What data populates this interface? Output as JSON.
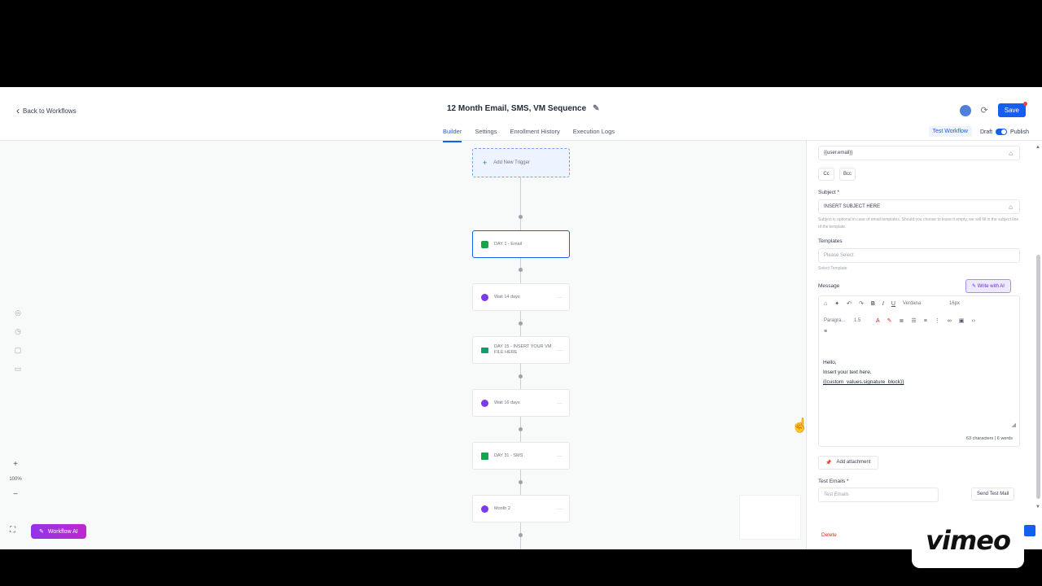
{
  "header": {
    "back_label": "Back to Workflows",
    "title": "12 Month Email, SMS, VM Sequence",
    "tabs": [
      {
        "label": "Builder",
        "active": true
      },
      {
        "label": "Settings"
      },
      {
        "label": "Enrollment History"
      },
      {
        "label": "Execution Logs"
      }
    ],
    "save_label": "Save",
    "test_workflow_label": "Test Workflow",
    "draft_label": "Draft",
    "publish_label": "Publish"
  },
  "canvas": {
    "add_trigger_label": "Add New Trigger",
    "nodes": [
      {
        "label": "DAY 1 - Email",
        "icon": "email-icon"
      },
      {
        "label": "Wait 14 days",
        "icon": "clock-icon"
      },
      {
        "label": "DAY 15 - INSERT YOUR VM FILE HERE",
        "icon": "voicemail-icon"
      },
      {
        "label": "Wait 16 days",
        "icon": "clock-icon"
      },
      {
        "label": "DAY 31 - SMS",
        "icon": "sms-icon"
      },
      {
        "label": "Month 2",
        "icon": "clock-icon"
      }
    ],
    "zoom_level": "100%",
    "workflow_ai_label": "Workflow AI"
  },
  "panel": {
    "to_value": "{{user.email}}",
    "cc_label": "Cc",
    "bcc_label": "Bcc",
    "subject_label": "Subject *",
    "subject_value": "INSERT SUBJECT HERE",
    "subject_hint": "Subject is optional in case of email templates. Should you choose to leave it empty, we will fill in the subject line of the template.",
    "templates_label": "Templates",
    "templates_placeholder": "Please Select",
    "templates_hint": "Select Template",
    "message_label": "Message",
    "write_ai_label": "Write with AI",
    "font_value": "Verdana",
    "size_value": "16px",
    "paragraph_value": "Paragra...",
    "line_height_value": "1.5",
    "body_line1": "Hello,",
    "body_line2": "Insert your text here.",
    "body_line3": "{{custom_values.signature_block}}",
    "counter": "63 characters | 6 words",
    "attachment_label": "Add attachment",
    "test_emails_label": "Test Emails *",
    "test_emails_placeholder": "Test Emails",
    "send_test_label": "Send Test Mail",
    "delete_label": "Delete"
  },
  "watermark": "vimeo"
}
